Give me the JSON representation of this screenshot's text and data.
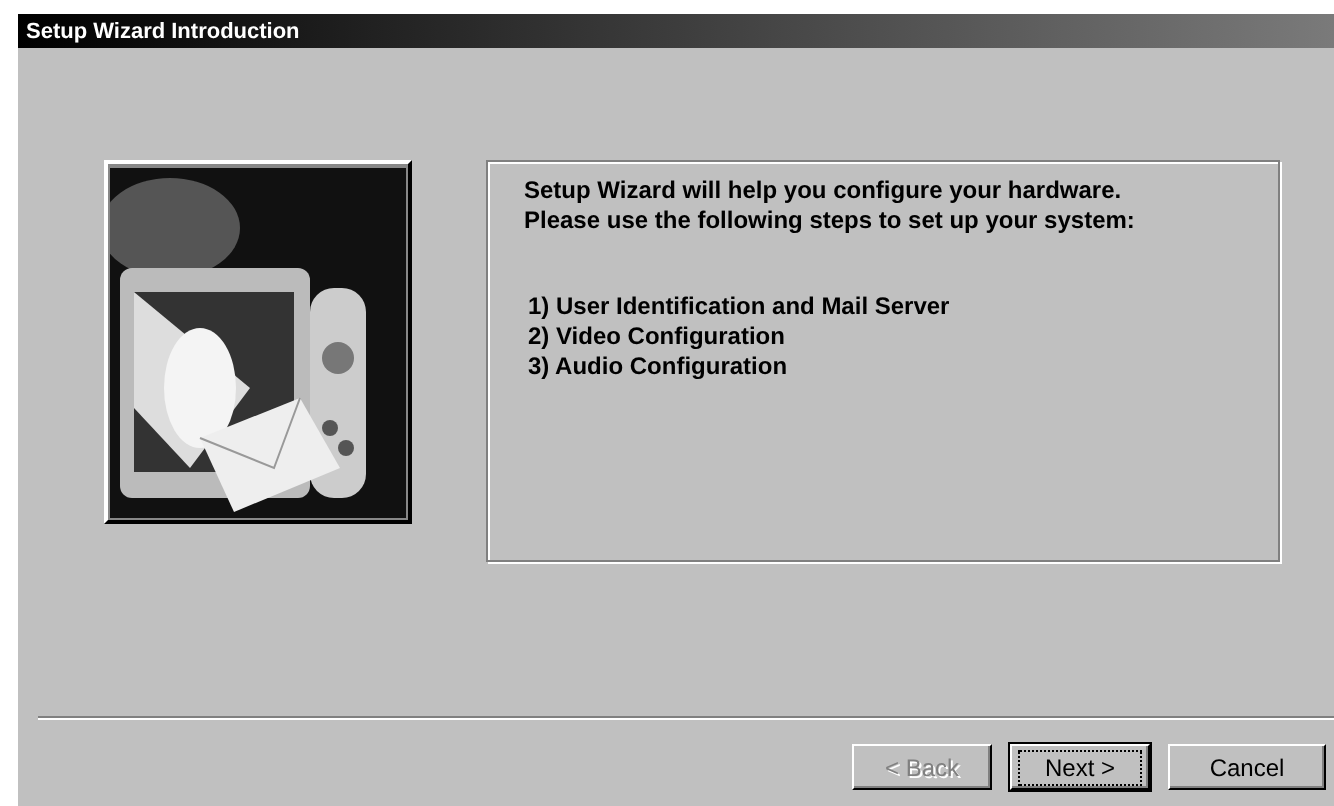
{
  "window": {
    "title": "Setup Wizard Introduction"
  },
  "illustration": {
    "kind": "picture"
  },
  "intro": [
    "Setup Wizard will help you configure your hardware.",
    "Please use the following steps to set up your system:"
  ],
  "steps": [
    "1) User Identification and Mail Server",
    "2) Video Configuration",
    "3) Audio Configuration"
  ],
  "buttons": [
    {
      "label": "< Back",
      "disabled": true,
      "default": false
    },
    {
      "label": "Next >",
      "disabled": false,
      "default": true
    },
    {
      "label": "Cancel",
      "disabled": false,
      "default": false
    }
  ]
}
